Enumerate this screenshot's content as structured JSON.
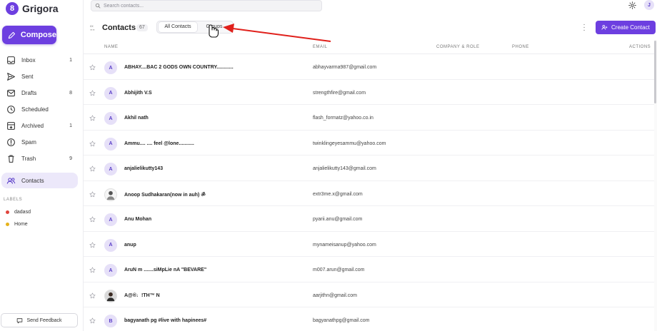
{
  "brand": {
    "logo_glyph": "8",
    "name": "Grigora"
  },
  "compose_label": "Compose",
  "search": {
    "placeholder": "Search contacts..."
  },
  "user_initial": "J",
  "nav": [
    {
      "label": "Inbox",
      "count": "1",
      "icon": "inbox-icon"
    },
    {
      "label": "Sent",
      "count": "",
      "icon": "send-icon"
    },
    {
      "label": "Drafts",
      "count": "8",
      "icon": "drafts-icon"
    },
    {
      "label": "Scheduled",
      "count": "",
      "icon": "clock-icon"
    },
    {
      "label": "Archived",
      "count": "1",
      "icon": "archive-icon"
    },
    {
      "label": "Spam",
      "count": "",
      "icon": "spam-icon"
    },
    {
      "label": "Trash",
      "count": "9",
      "icon": "trash-icon"
    },
    {
      "label": "Contacts",
      "count": "",
      "icon": "contacts-icon",
      "active": true
    }
  ],
  "labels": {
    "heading": "LABELS",
    "items": [
      {
        "name": "dadasd",
        "color": "#e0443c"
      },
      {
        "name": "Home",
        "color": "#e6b21a"
      }
    ]
  },
  "feedback_label": "Send Feedback",
  "header": {
    "title": "Contacts",
    "count": "67",
    "tabs": [
      "All Contacts",
      "Groups"
    ],
    "create_label": "Create Contact"
  },
  "table": {
    "columns": [
      "NAME",
      "EMAIL",
      "COMPANY & ROLE",
      "PHONE",
      "ACTIONS"
    ],
    "rows": [
      {
        "initial": "A",
        "name": "ABHAY....BAC 2 GODS OWN COUNTRY............",
        "email": "abhayvarma987@gmail.com"
      },
      {
        "initial": "A",
        "name": "Abhijith V.S",
        "email": "strengthfire@gmail.com"
      },
      {
        "initial": "A",
        "name": "Akhil nath",
        "email": "flash_formatz@yahoo.co.in"
      },
      {
        "initial": "A",
        "name": "Ammu.... .... feel @lone...........",
        "email": "twinklingeyesammu@yahoo.com"
      },
      {
        "initial": "A",
        "name": "anjalielikutty143",
        "email": "anjalielikutty143@gmail.com"
      },
      {
        "initial": "",
        "photo": true,
        "name": "Anoop Sudhakaran(now in auh) ॐ",
        "email": "extr3me.x@gmail.com"
      },
      {
        "initial": "A",
        "name": "Anu Mohan",
        "email": "pyarii.anu@gmail.com"
      },
      {
        "initial": "A",
        "name": "anup",
        "email": "mynameisanup@yahoo.com"
      },
      {
        "initial": "A",
        "name": "AruN m .......siMpLie nA \"BEVARE\"",
        "email": "m007.arun@gmail.com"
      },
      {
        "initial": "",
        "photo": true,
        "name": "A@®♩!TH™ N",
        "email": "aarjithn@gmail.com"
      },
      {
        "initial": "B",
        "name": "bagyanath pg #live with hapinees#",
        "email": "bagyanathpg@gmail.com"
      }
    ]
  }
}
